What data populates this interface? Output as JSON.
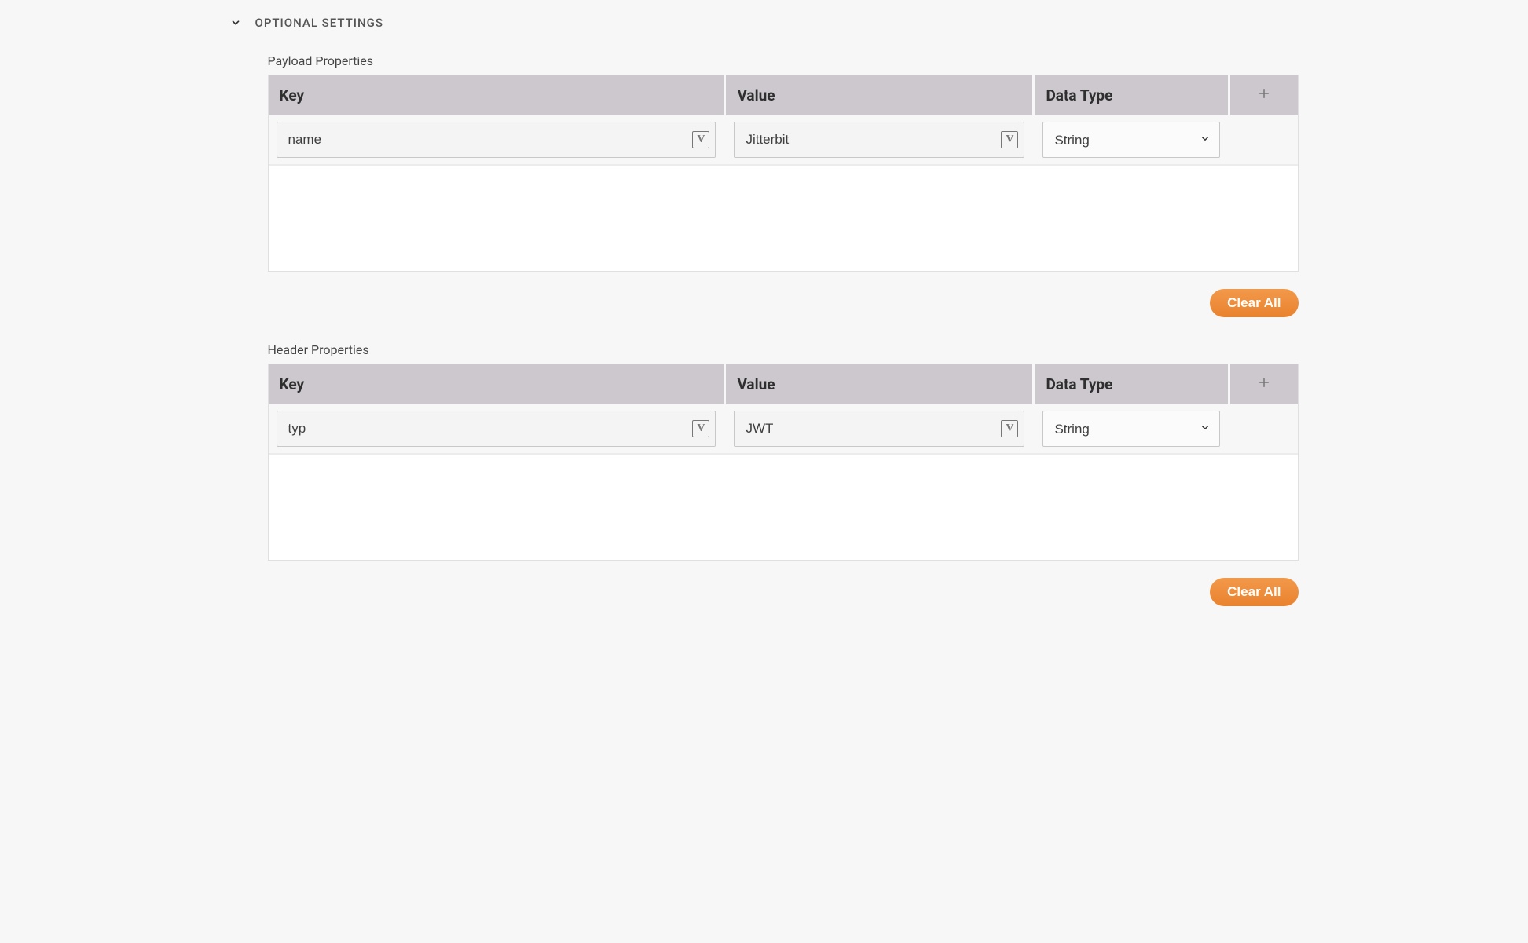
{
  "header": {
    "title": "OPTIONAL SETTINGS"
  },
  "sections": {
    "payload": {
      "title": "Payload Properties",
      "columns": {
        "key": "Key",
        "value": "Value",
        "type": "Data Type"
      },
      "row": {
        "key": "name",
        "value": "Jitterbit",
        "type": "String"
      },
      "clear": "Clear All"
    },
    "headerprops": {
      "title": "Header Properties",
      "columns": {
        "key": "Key",
        "value": "Value",
        "type": "Data Type"
      },
      "row": {
        "key": "typ",
        "value": "JWT",
        "type": "String"
      },
      "clear": "Clear All"
    }
  },
  "dataTypeOptions": [
    "String"
  ]
}
